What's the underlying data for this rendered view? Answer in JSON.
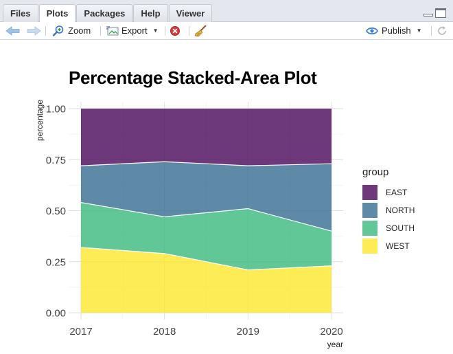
{
  "tabs": [
    {
      "label": "Files"
    },
    {
      "label": "Plots"
    },
    {
      "label": "Packages"
    },
    {
      "label": "Help"
    },
    {
      "label": "Viewer"
    }
  ],
  "toolbar": {
    "zoom_label": "Zoom",
    "export_label": "Export",
    "publish_label": "Publish"
  },
  "chart_data": {
    "type": "area",
    "stacked": "percentage",
    "title": "Percentage Stacked-Area Plot",
    "xlabel": "year",
    "ylabel": "percentage",
    "x": [
      2017,
      2018,
      2019,
      2020
    ],
    "x_ticks": [
      "2017",
      "2018",
      "2019",
      "2020"
    ],
    "ylim": [
      0,
      1
    ],
    "y_ticks": [
      "0.00",
      "0.25",
      "0.50",
      "0.75",
      "1.00"
    ],
    "grid": true,
    "legend": {
      "title": "group",
      "position": "right"
    },
    "series": [
      {
        "name": "EAST",
        "color": "#440154",
        "values": [
          0.28,
          0.26,
          0.28,
          0.27
        ]
      },
      {
        "name": "NORTH",
        "color": "#31688E",
        "values": [
          0.18,
          0.27,
          0.21,
          0.33
        ]
      },
      {
        "name": "SOUTH",
        "color": "#35B779",
        "values": [
          0.22,
          0.18,
          0.3,
          0.17
        ]
      },
      {
        "name": "WEST",
        "color": "#FDE725",
        "values": [
          0.32,
          0.29,
          0.21,
          0.23
        ]
      }
    ]
  }
}
